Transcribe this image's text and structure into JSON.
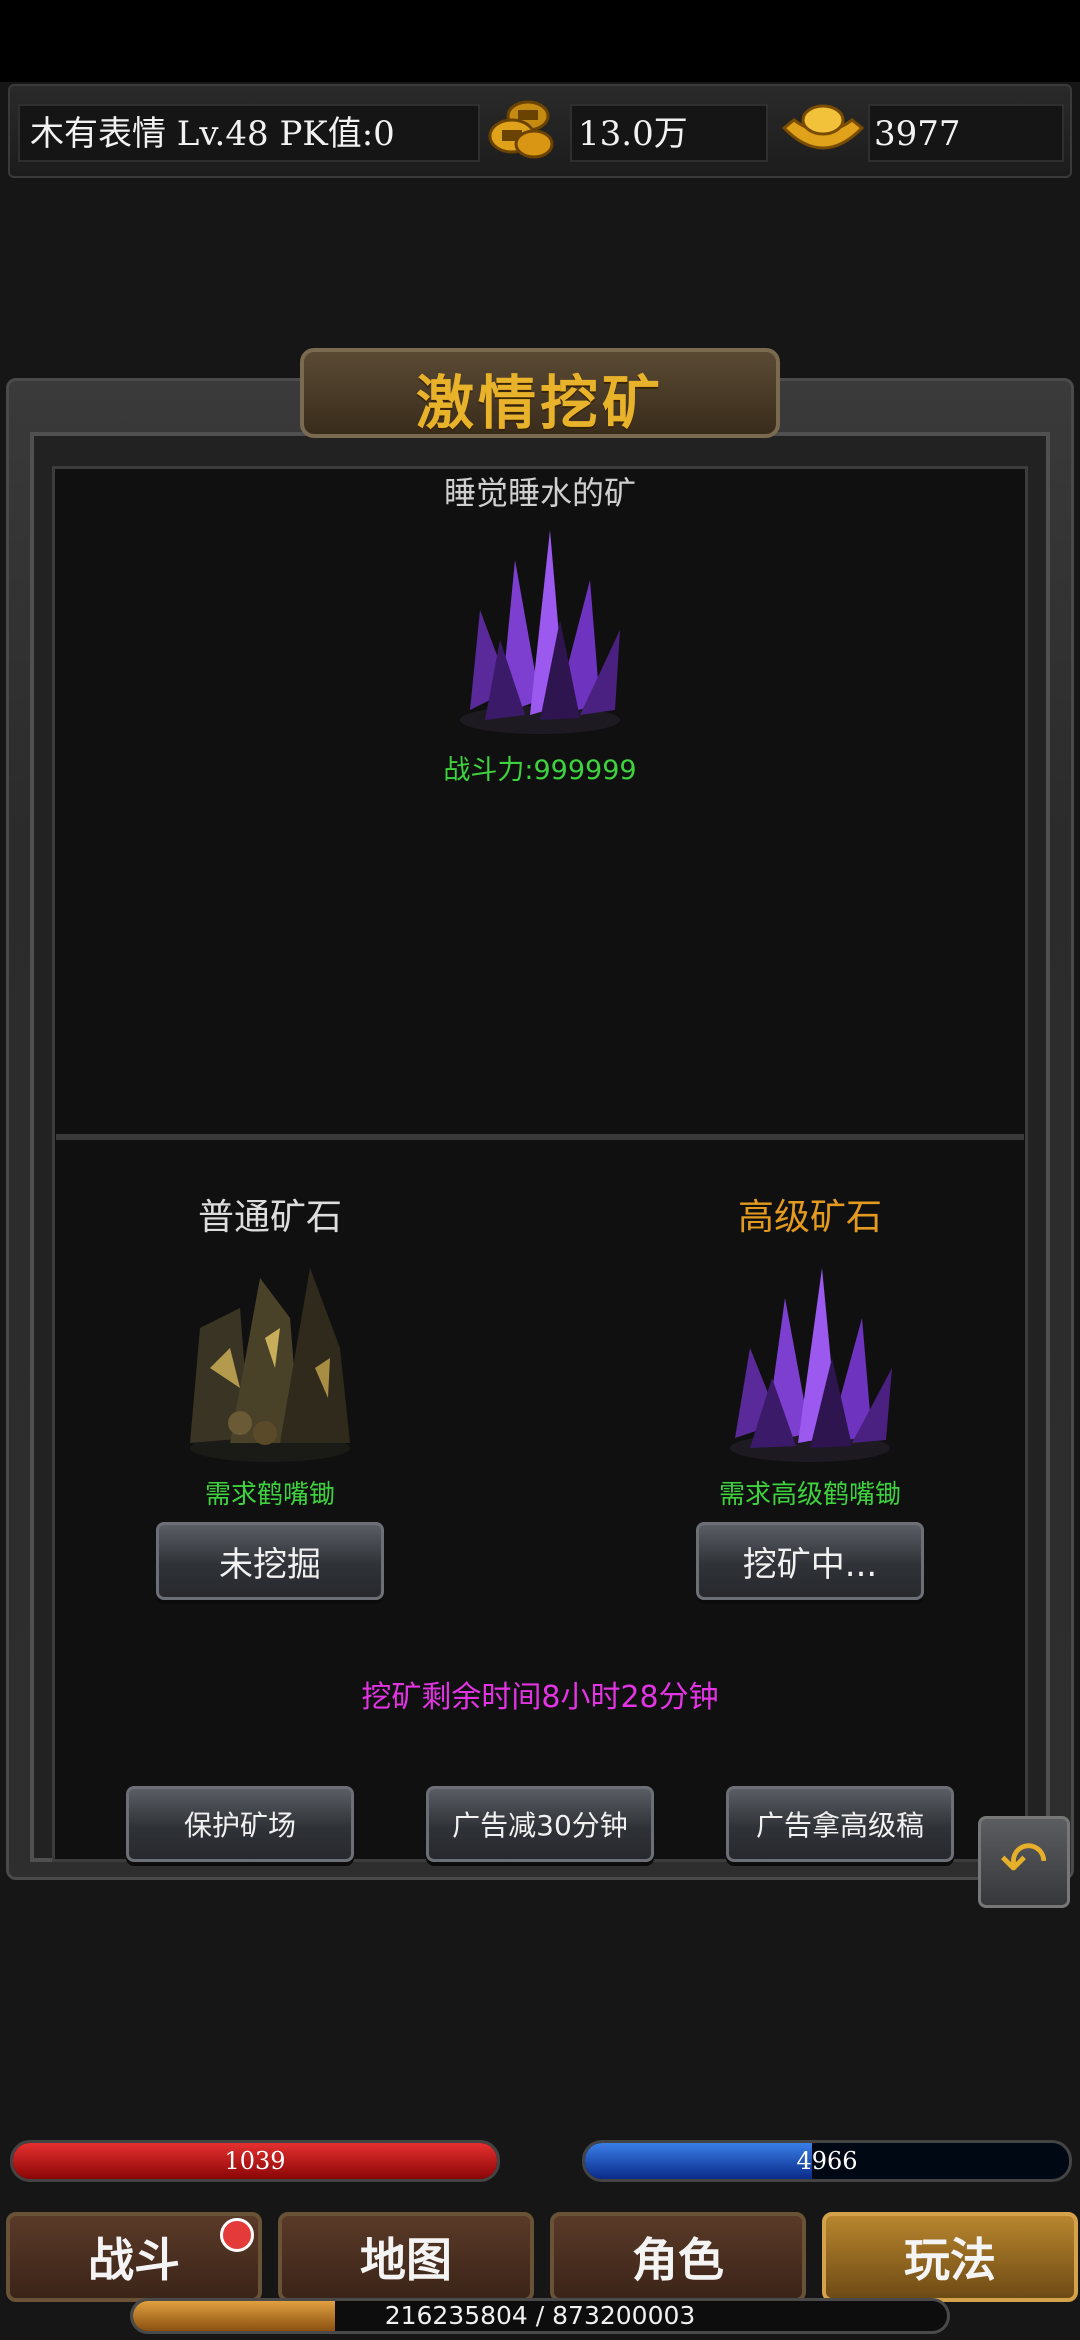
{
  "player": {
    "info": "木有表情  Lv.48 PK值:0",
    "gold": "13.0万",
    "ingot": "3977"
  },
  "panel": {
    "title": "激情挖矿",
    "mine_name": "睡觉睡水的矿",
    "power": "战斗力:999999"
  },
  "ores": [
    {
      "label": "普通矿石",
      "label_color": "#7b7b7b",
      "requirement": "需求鹤嘴锄",
      "button": "未挖掘"
    },
    {
      "label": "高级矿石",
      "label_color": "#e39a1e",
      "requirement": "需求高级鹤嘴锄",
      "button": "挖矿中..."
    }
  ],
  "timer_text": "挖矿剩余时间8小时28分钟",
  "actions": {
    "protect": "保护矿场",
    "ad_reduce": "广告减30分钟",
    "ad_pickaxe": "广告拿高级稿"
  },
  "bars": {
    "hp_text": "1039",
    "hp_fraction": 1.0,
    "mp_text": "4966",
    "mp_fraction": 0.47,
    "exp_text": "216235804 / 873200003",
    "exp_fraction": 0.2476
  },
  "nav": {
    "battle": "战斗",
    "map": "地图",
    "character": "角色",
    "gameplay": "玩法"
  },
  "icons": {
    "gold": "gold-coin-icon",
    "ingot": "gold-ingot-icon",
    "back": "back-arrow-icon"
  }
}
